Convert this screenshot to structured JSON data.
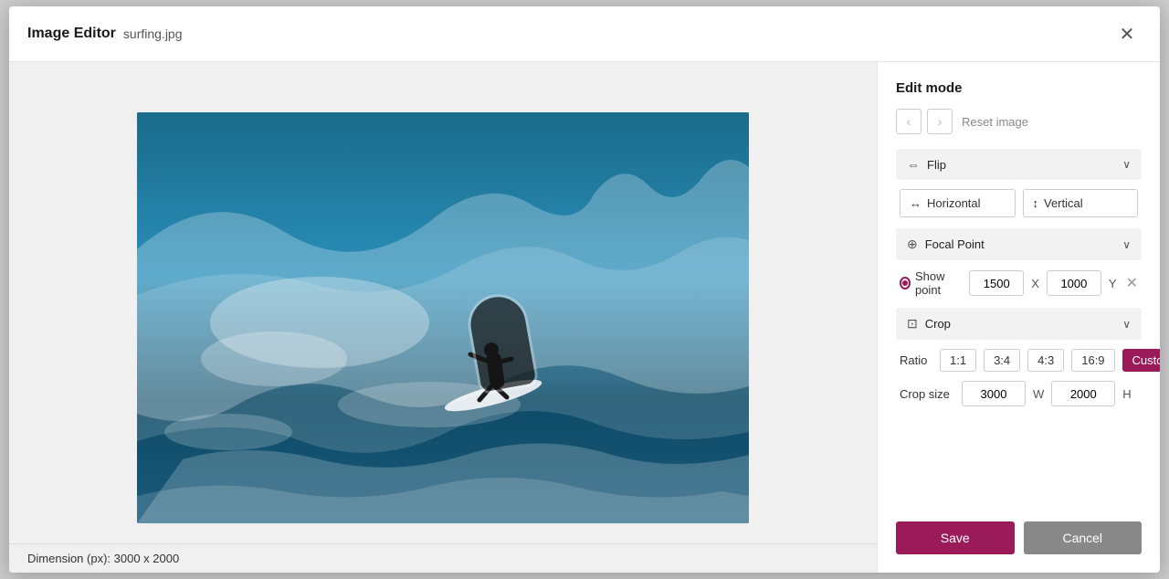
{
  "modal": {
    "title": "Image Editor",
    "filename": "surfing.jpg",
    "close_icon": "✕"
  },
  "image": {
    "dimension_label": "Dimension (px): 3000 x 2000"
  },
  "right_panel": {
    "edit_mode_label": "Edit mode",
    "nav": {
      "back_icon": "‹",
      "forward_icon": "›",
      "reset_label": "Reset image"
    },
    "flip_section": {
      "label": "Flip",
      "icon": "⇔",
      "chevron": "∨",
      "horizontal_btn": "Horizontal",
      "vertical_btn": "Vertical"
    },
    "focal_section": {
      "label": "Focal Point",
      "chevron": "∨",
      "show_point_label": "Show point",
      "x_value": "1500",
      "x_label": "X",
      "y_value": "1000",
      "y_label": "Y",
      "clear_icon": "✕"
    },
    "crop_section": {
      "label": "Crop",
      "chevron": "∨",
      "ratio_label": "Ratio",
      "ratio_options": [
        "1:1",
        "3:4",
        "4:3",
        "16:9",
        "Custom"
      ],
      "active_ratio": "Custom",
      "crop_size_label": "Crop size",
      "width_value": "3000",
      "width_label": "W",
      "height_value": "2000",
      "height_label": "H"
    },
    "save_label": "Save",
    "cancel_label": "Cancel"
  }
}
